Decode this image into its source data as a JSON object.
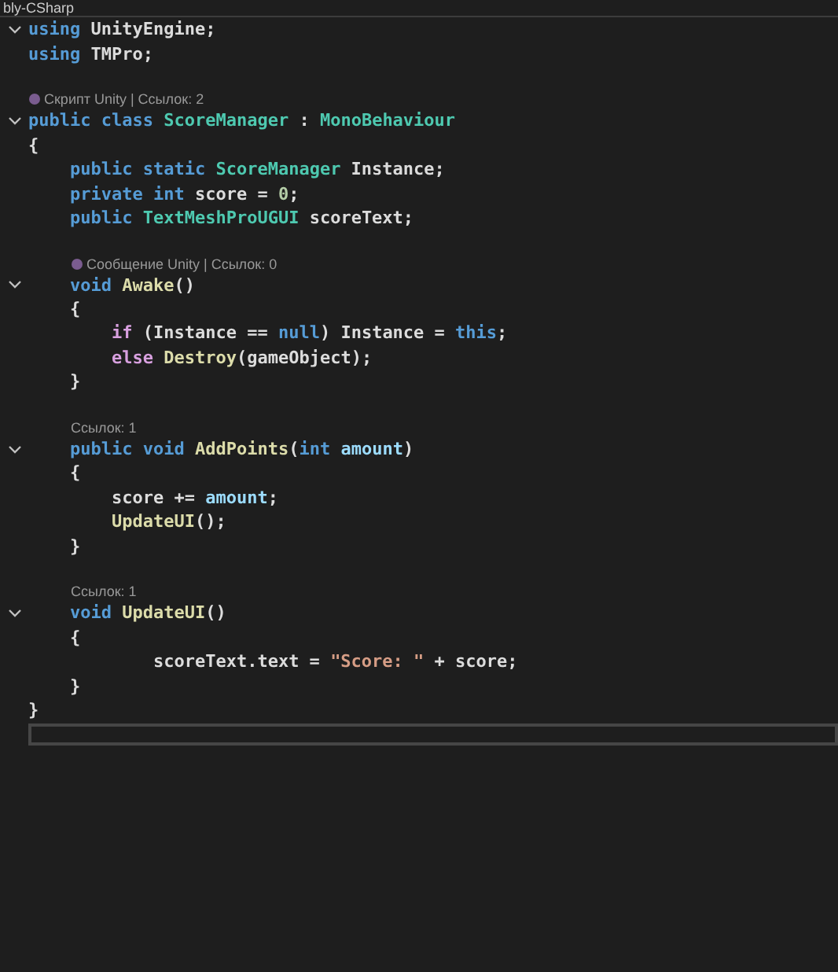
{
  "tab": {
    "title": "bly-CSharp"
  },
  "lines": [
    {
      "kind": "code",
      "expanded": true,
      "tokens": [
        {
          "kind": "keyword",
          "text": "using"
        },
        {
          "kind": "plain",
          "text": " UnityEngine;"
        }
      ]
    },
    {
      "kind": "code",
      "tokens": [
        {
          "kind": "keyword",
          "text": "using"
        },
        {
          "kind": "plain",
          "text": " TMPro;"
        }
      ]
    },
    {
      "kind": "blank"
    },
    {
      "kind": "lens",
      "unity_icon": true,
      "indented": false,
      "text": "Скрипт Unity | Ссылок: 2"
    },
    {
      "kind": "code",
      "expanded": true,
      "tokens": [
        {
          "kind": "keyword",
          "text": "public class"
        },
        {
          "kind": "type",
          "text": " ScoreManager"
        },
        {
          "kind": "plain",
          "text": " : "
        },
        {
          "kind": "type",
          "text": "MonoBehaviour"
        }
      ]
    },
    {
      "kind": "code",
      "tokens": [
        {
          "kind": "plain",
          "text": "{"
        }
      ]
    },
    {
      "kind": "code",
      "tokens": [
        {
          "kind": "keyword",
          "text": "    public static"
        },
        {
          "kind": "type",
          "text": " ScoreManager"
        },
        {
          "kind": "plain",
          "text": " Instance;"
        }
      ]
    },
    {
      "kind": "code",
      "tokens": [
        {
          "kind": "keyword",
          "text": "    private int"
        },
        {
          "kind": "plain",
          "text": " score = "
        },
        {
          "kind": "number",
          "text": "0"
        },
        {
          "kind": "plain",
          "text": ";"
        }
      ]
    },
    {
      "kind": "code",
      "tokens": [
        {
          "kind": "keyword",
          "text": "    public"
        },
        {
          "kind": "type",
          "text": " TextMeshProUGUI"
        },
        {
          "kind": "plain",
          "text": " scoreText;"
        }
      ]
    },
    {
      "kind": "blank"
    },
    {
      "kind": "lens",
      "unity_icon": true,
      "indented": true,
      "text": "Сообщение Unity | Ссылок: 0"
    },
    {
      "kind": "code",
      "expanded": true,
      "tokens": [
        {
          "kind": "keyword",
          "text": "    void"
        },
        {
          "kind": "method",
          "text": " Awake"
        },
        {
          "kind": "plain",
          "text": "()"
        }
      ]
    },
    {
      "kind": "code",
      "tokens": [
        {
          "kind": "plain",
          "text": "    {"
        }
      ]
    },
    {
      "kind": "code",
      "tokens": [
        {
          "kind": "control",
          "text": "        if"
        },
        {
          "kind": "plain",
          "text": " (Instance == "
        },
        {
          "kind": "keyword",
          "text": "null"
        },
        {
          "kind": "plain",
          "text": ") Instance = "
        },
        {
          "kind": "keyword",
          "text": "this"
        },
        {
          "kind": "plain",
          "text": ";"
        }
      ]
    },
    {
      "kind": "code",
      "tokens": [
        {
          "kind": "control",
          "text": "        else"
        },
        {
          "kind": "method",
          "text": " Destroy"
        },
        {
          "kind": "plain",
          "text": "(gameObject);"
        }
      ]
    },
    {
      "kind": "code",
      "tokens": [
        {
          "kind": "plain",
          "text": "    }"
        }
      ]
    },
    {
      "kind": "blank"
    },
    {
      "kind": "lens",
      "unity_icon": false,
      "indented": true,
      "text": "Ссылок: 1"
    },
    {
      "kind": "code",
      "expanded": true,
      "tokens": [
        {
          "kind": "keyword",
          "text": "    public void"
        },
        {
          "kind": "method",
          "text": " AddPoints"
        },
        {
          "kind": "plain",
          "text": "("
        },
        {
          "kind": "keyword",
          "text": "int"
        },
        {
          "kind": "param",
          "text": " amount"
        },
        {
          "kind": "plain",
          "text": ")"
        }
      ]
    },
    {
      "kind": "code",
      "tokens": [
        {
          "kind": "plain",
          "text": "    {"
        }
      ]
    },
    {
      "kind": "code",
      "tokens": [
        {
          "kind": "plain",
          "text": "        score += "
        },
        {
          "kind": "param",
          "text": "amount"
        },
        {
          "kind": "plain",
          "text": ";"
        }
      ]
    },
    {
      "kind": "code",
      "tokens": [
        {
          "kind": "method",
          "text": "        UpdateUI"
        },
        {
          "kind": "plain",
          "text": "();"
        }
      ]
    },
    {
      "kind": "code",
      "tokens": [
        {
          "kind": "plain",
          "text": "    }"
        }
      ]
    },
    {
      "kind": "blank"
    },
    {
      "kind": "lens",
      "unity_icon": false,
      "indented": true,
      "text": "Ссылок: 1"
    },
    {
      "kind": "code",
      "expanded": true,
      "tokens": [
        {
          "kind": "keyword",
          "text": "    void"
        },
        {
          "kind": "method",
          "text": " UpdateUI"
        },
        {
          "kind": "plain",
          "text": "()"
        }
      ]
    },
    {
      "kind": "code",
      "tokens": [
        {
          "kind": "plain",
          "text": "    {"
        }
      ]
    },
    {
      "kind": "code",
      "tokens": [
        {
          "kind": "plain",
          "text": "            scoreText.text = "
        },
        {
          "kind": "string",
          "text": "\"Score: \""
        },
        {
          "kind": "plain",
          "text": " + score;"
        }
      ]
    },
    {
      "kind": "code",
      "tokens": [
        {
          "kind": "plain",
          "text": "    }"
        }
      ]
    },
    {
      "kind": "code",
      "tokens": [
        {
          "kind": "plain",
          "text": "}"
        }
      ]
    },
    {
      "kind": "current"
    }
  ]
}
